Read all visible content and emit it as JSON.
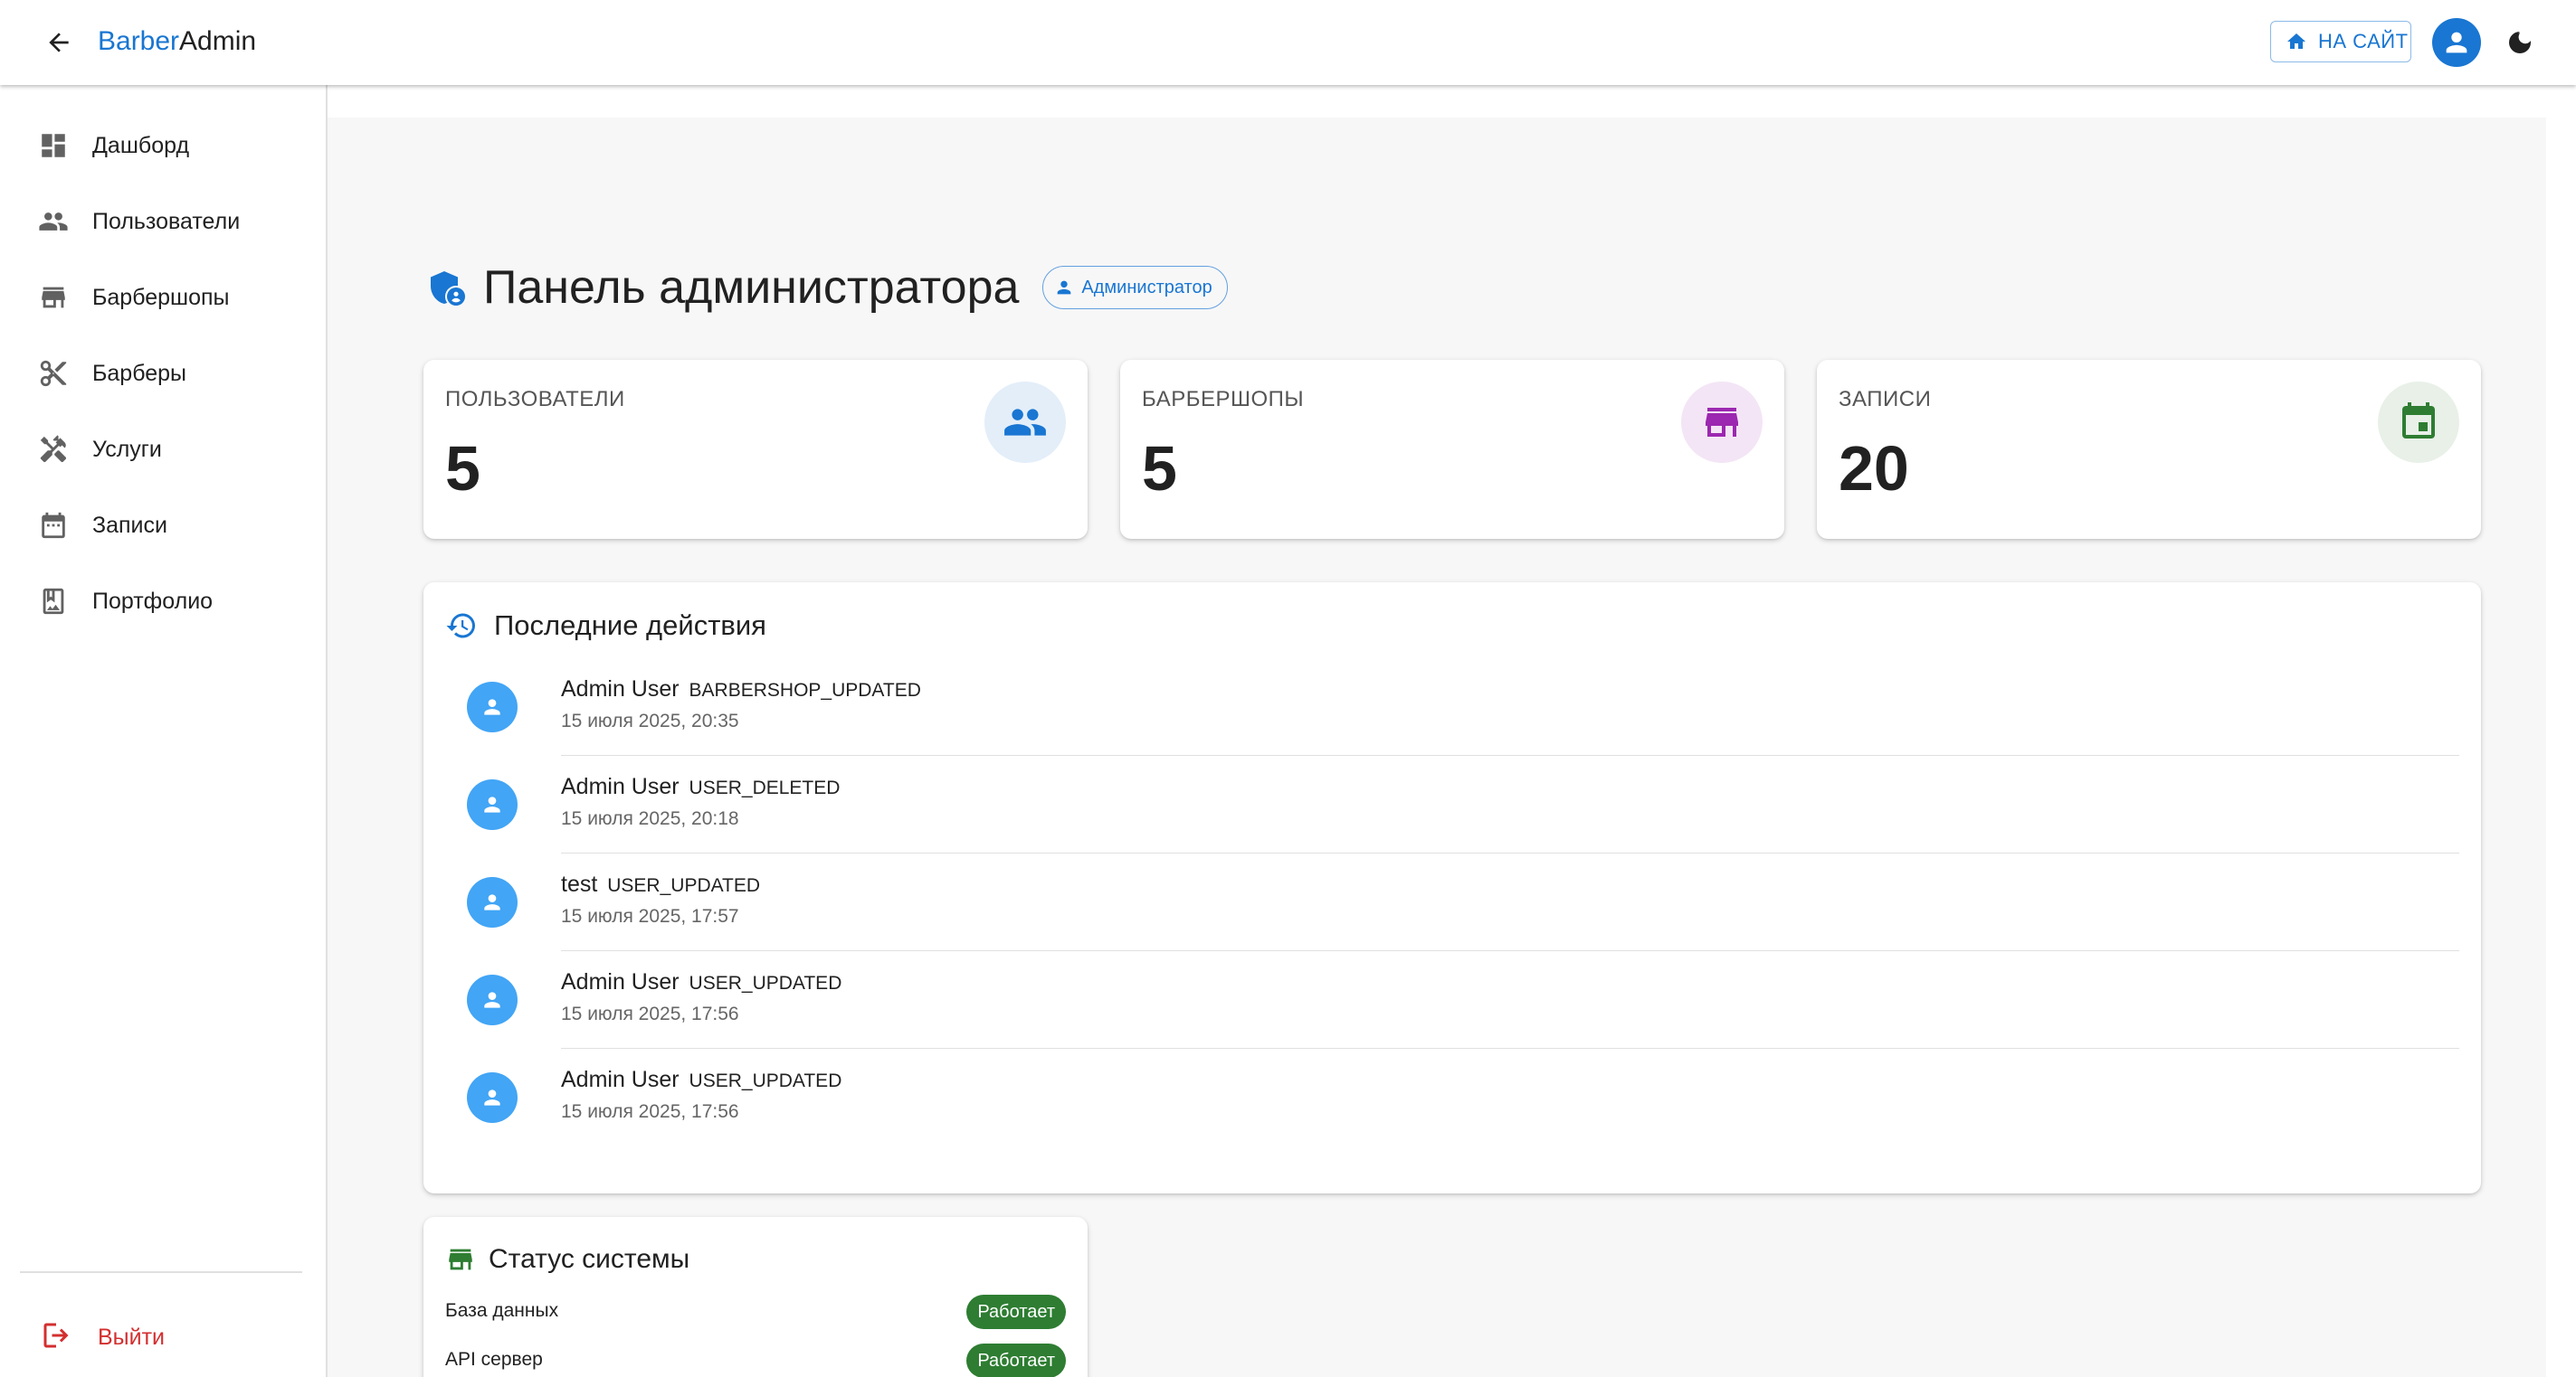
{
  "header": {
    "brand_part1": "Barber",
    "brand_part2": "Admin",
    "site_button": "НА САЙТ"
  },
  "sidebar": {
    "items": [
      {
        "label": "Дашборд",
        "icon": "dashboard-icon"
      },
      {
        "label": "Пользователи",
        "icon": "people-icon"
      },
      {
        "label": "Барбершопы",
        "icon": "store-icon"
      },
      {
        "label": "Барберы",
        "icon": "scissors-icon"
      },
      {
        "label": "Услуги",
        "icon": "tools-icon"
      },
      {
        "label": "Записи",
        "icon": "calendar-icon"
      },
      {
        "label": "Портфолио",
        "icon": "portfolio-icon"
      }
    ],
    "logout": "Выйти"
  },
  "page": {
    "title": "Панель администратора",
    "role_chip": "Администратор"
  },
  "stats": [
    {
      "label": "ПОЛЬЗОВАТЕЛИ",
      "value": "5",
      "icon": "people-icon",
      "color": "#1976d2",
      "bg": "#e3eef9"
    },
    {
      "label": "БАРБЕРШОПЫ",
      "value": "5",
      "icon": "store-icon",
      "color": "#9c27b0",
      "bg": "#f3e5f5"
    },
    {
      "label": "ЗАПИСИ",
      "value": "20",
      "icon": "calendar-icon",
      "color": "#2e7d32",
      "bg": "#e8f0e8"
    }
  ],
  "activity": {
    "title": "Последние действия",
    "items": [
      {
        "user": "Admin User",
        "action": "BARBERSHOP_UPDATED",
        "time": "15 июля 2025, 20:35"
      },
      {
        "user": "Admin User",
        "action": "USER_DELETED",
        "time": "15 июля 2025, 20:18"
      },
      {
        "user": "test",
        "action": "USER_UPDATED",
        "time": "15 июля 2025, 17:57"
      },
      {
        "user": "Admin User",
        "action": "USER_UPDATED",
        "time": "15 июля 2025, 17:56"
      },
      {
        "user": "Admin User",
        "action": "USER_UPDATED",
        "time": "15 июля 2025, 17:56"
      }
    ]
  },
  "system_status": {
    "title": "Статус системы",
    "items": [
      {
        "name": "База данных",
        "status": "Работает"
      },
      {
        "name": "API сервер",
        "status": "Работает"
      }
    ]
  },
  "colors": {
    "primary": "#1976d2",
    "danger": "#d32f2f",
    "success": "#2e7d32",
    "avatar": "#42a5f5"
  }
}
